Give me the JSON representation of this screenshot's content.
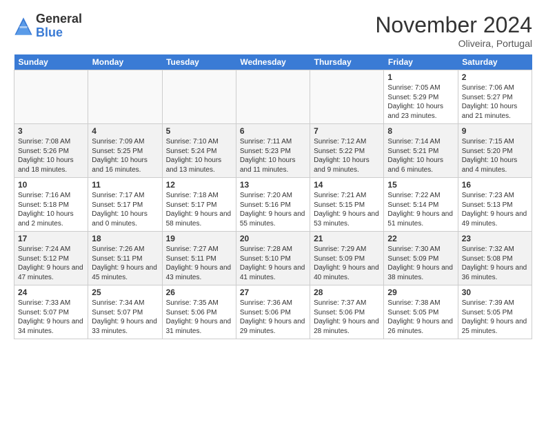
{
  "logo": {
    "general": "General",
    "blue": "Blue"
  },
  "header": {
    "month": "November 2024",
    "location": "Oliveira, Portugal"
  },
  "weekdays": [
    "Sunday",
    "Monday",
    "Tuesday",
    "Wednesday",
    "Thursday",
    "Friday",
    "Saturday"
  ],
  "weeks": [
    [
      {
        "day": "",
        "info": ""
      },
      {
        "day": "",
        "info": ""
      },
      {
        "day": "",
        "info": ""
      },
      {
        "day": "",
        "info": ""
      },
      {
        "day": "",
        "info": ""
      },
      {
        "day": "1",
        "info": "Sunrise: 7:05 AM\nSunset: 5:29 PM\nDaylight: 10 hours\nand 23 minutes."
      },
      {
        "day": "2",
        "info": "Sunrise: 7:06 AM\nSunset: 5:27 PM\nDaylight: 10 hours\nand 21 minutes."
      }
    ],
    [
      {
        "day": "3",
        "info": "Sunrise: 7:08 AM\nSunset: 5:26 PM\nDaylight: 10 hours\nand 18 minutes."
      },
      {
        "day": "4",
        "info": "Sunrise: 7:09 AM\nSunset: 5:25 PM\nDaylight: 10 hours\nand 16 minutes."
      },
      {
        "day": "5",
        "info": "Sunrise: 7:10 AM\nSunset: 5:24 PM\nDaylight: 10 hours\nand 13 minutes."
      },
      {
        "day": "6",
        "info": "Sunrise: 7:11 AM\nSunset: 5:23 PM\nDaylight: 10 hours\nand 11 minutes."
      },
      {
        "day": "7",
        "info": "Sunrise: 7:12 AM\nSunset: 5:22 PM\nDaylight: 10 hours\nand 9 minutes."
      },
      {
        "day": "8",
        "info": "Sunrise: 7:14 AM\nSunset: 5:21 PM\nDaylight: 10 hours\nand 6 minutes."
      },
      {
        "day": "9",
        "info": "Sunrise: 7:15 AM\nSunset: 5:20 PM\nDaylight: 10 hours\nand 4 minutes."
      }
    ],
    [
      {
        "day": "10",
        "info": "Sunrise: 7:16 AM\nSunset: 5:18 PM\nDaylight: 10 hours\nand 2 minutes."
      },
      {
        "day": "11",
        "info": "Sunrise: 7:17 AM\nSunset: 5:17 PM\nDaylight: 10 hours\nand 0 minutes."
      },
      {
        "day": "12",
        "info": "Sunrise: 7:18 AM\nSunset: 5:17 PM\nDaylight: 9 hours\nand 58 minutes."
      },
      {
        "day": "13",
        "info": "Sunrise: 7:20 AM\nSunset: 5:16 PM\nDaylight: 9 hours\nand 55 minutes."
      },
      {
        "day": "14",
        "info": "Sunrise: 7:21 AM\nSunset: 5:15 PM\nDaylight: 9 hours\nand 53 minutes."
      },
      {
        "day": "15",
        "info": "Sunrise: 7:22 AM\nSunset: 5:14 PM\nDaylight: 9 hours\nand 51 minutes."
      },
      {
        "day": "16",
        "info": "Sunrise: 7:23 AM\nSunset: 5:13 PM\nDaylight: 9 hours\nand 49 minutes."
      }
    ],
    [
      {
        "day": "17",
        "info": "Sunrise: 7:24 AM\nSunset: 5:12 PM\nDaylight: 9 hours\nand 47 minutes."
      },
      {
        "day": "18",
        "info": "Sunrise: 7:26 AM\nSunset: 5:11 PM\nDaylight: 9 hours\nand 45 minutes."
      },
      {
        "day": "19",
        "info": "Sunrise: 7:27 AM\nSunset: 5:11 PM\nDaylight: 9 hours\nand 43 minutes."
      },
      {
        "day": "20",
        "info": "Sunrise: 7:28 AM\nSunset: 5:10 PM\nDaylight: 9 hours\nand 41 minutes."
      },
      {
        "day": "21",
        "info": "Sunrise: 7:29 AM\nSunset: 5:09 PM\nDaylight: 9 hours\nand 40 minutes."
      },
      {
        "day": "22",
        "info": "Sunrise: 7:30 AM\nSunset: 5:09 PM\nDaylight: 9 hours\nand 38 minutes."
      },
      {
        "day": "23",
        "info": "Sunrise: 7:32 AM\nSunset: 5:08 PM\nDaylight: 9 hours\nand 36 minutes."
      }
    ],
    [
      {
        "day": "24",
        "info": "Sunrise: 7:33 AM\nSunset: 5:07 PM\nDaylight: 9 hours\nand 34 minutes."
      },
      {
        "day": "25",
        "info": "Sunrise: 7:34 AM\nSunset: 5:07 PM\nDaylight: 9 hours\nand 33 minutes."
      },
      {
        "day": "26",
        "info": "Sunrise: 7:35 AM\nSunset: 5:06 PM\nDaylight: 9 hours\nand 31 minutes."
      },
      {
        "day": "27",
        "info": "Sunrise: 7:36 AM\nSunset: 5:06 PM\nDaylight: 9 hours\nand 29 minutes."
      },
      {
        "day": "28",
        "info": "Sunrise: 7:37 AM\nSunset: 5:06 PM\nDaylight: 9 hours\nand 28 minutes."
      },
      {
        "day": "29",
        "info": "Sunrise: 7:38 AM\nSunset: 5:05 PM\nDaylight: 9 hours\nand 26 minutes."
      },
      {
        "day": "30",
        "info": "Sunrise: 7:39 AM\nSunset: 5:05 PM\nDaylight: 9 hours\nand 25 minutes."
      }
    ]
  ]
}
